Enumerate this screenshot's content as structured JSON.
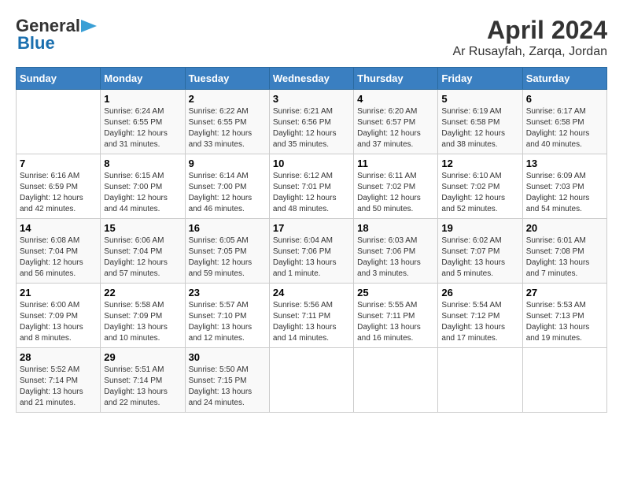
{
  "header": {
    "logo_general": "General",
    "logo_blue": "Blue",
    "title": "April 2024",
    "subtitle": "Ar Rusayfah, Zarqa, Jordan"
  },
  "days_of_week": [
    "Sunday",
    "Monday",
    "Tuesday",
    "Wednesday",
    "Thursday",
    "Friday",
    "Saturday"
  ],
  "weeks": [
    [
      {
        "day": "",
        "info": ""
      },
      {
        "day": "1",
        "info": "Sunrise: 6:24 AM\nSunset: 6:55 PM\nDaylight: 12 hours\nand 31 minutes."
      },
      {
        "day": "2",
        "info": "Sunrise: 6:22 AM\nSunset: 6:55 PM\nDaylight: 12 hours\nand 33 minutes."
      },
      {
        "day": "3",
        "info": "Sunrise: 6:21 AM\nSunset: 6:56 PM\nDaylight: 12 hours\nand 35 minutes."
      },
      {
        "day": "4",
        "info": "Sunrise: 6:20 AM\nSunset: 6:57 PM\nDaylight: 12 hours\nand 37 minutes."
      },
      {
        "day": "5",
        "info": "Sunrise: 6:19 AM\nSunset: 6:58 PM\nDaylight: 12 hours\nand 38 minutes."
      },
      {
        "day": "6",
        "info": "Sunrise: 6:17 AM\nSunset: 6:58 PM\nDaylight: 12 hours\nand 40 minutes."
      }
    ],
    [
      {
        "day": "7",
        "info": "Sunrise: 6:16 AM\nSunset: 6:59 PM\nDaylight: 12 hours\nand 42 minutes."
      },
      {
        "day": "8",
        "info": "Sunrise: 6:15 AM\nSunset: 7:00 PM\nDaylight: 12 hours\nand 44 minutes."
      },
      {
        "day": "9",
        "info": "Sunrise: 6:14 AM\nSunset: 7:00 PM\nDaylight: 12 hours\nand 46 minutes."
      },
      {
        "day": "10",
        "info": "Sunrise: 6:12 AM\nSunset: 7:01 PM\nDaylight: 12 hours\nand 48 minutes."
      },
      {
        "day": "11",
        "info": "Sunrise: 6:11 AM\nSunset: 7:02 PM\nDaylight: 12 hours\nand 50 minutes."
      },
      {
        "day": "12",
        "info": "Sunrise: 6:10 AM\nSunset: 7:02 PM\nDaylight: 12 hours\nand 52 minutes."
      },
      {
        "day": "13",
        "info": "Sunrise: 6:09 AM\nSunset: 7:03 PM\nDaylight: 12 hours\nand 54 minutes."
      }
    ],
    [
      {
        "day": "14",
        "info": "Sunrise: 6:08 AM\nSunset: 7:04 PM\nDaylight: 12 hours\nand 56 minutes."
      },
      {
        "day": "15",
        "info": "Sunrise: 6:06 AM\nSunset: 7:04 PM\nDaylight: 12 hours\nand 57 minutes."
      },
      {
        "day": "16",
        "info": "Sunrise: 6:05 AM\nSunset: 7:05 PM\nDaylight: 12 hours\nand 59 minutes."
      },
      {
        "day": "17",
        "info": "Sunrise: 6:04 AM\nSunset: 7:06 PM\nDaylight: 13 hours\nand 1 minute."
      },
      {
        "day": "18",
        "info": "Sunrise: 6:03 AM\nSunset: 7:06 PM\nDaylight: 13 hours\nand 3 minutes."
      },
      {
        "day": "19",
        "info": "Sunrise: 6:02 AM\nSunset: 7:07 PM\nDaylight: 13 hours\nand 5 minutes."
      },
      {
        "day": "20",
        "info": "Sunrise: 6:01 AM\nSunset: 7:08 PM\nDaylight: 13 hours\nand 7 minutes."
      }
    ],
    [
      {
        "day": "21",
        "info": "Sunrise: 6:00 AM\nSunset: 7:09 PM\nDaylight: 13 hours\nand 8 minutes."
      },
      {
        "day": "22",
        "info": "Sunrise: 5:58 AM\nSunset: 7:09 PM\nDaylight: 13 hours\nand 10 minutes."
      },
      {
        "day": "23",
        "info": "Sunrise: 5:57 AM\nSunset: 7:10 PM\nDaylight: 13 hours\nand 12 minutes."
      },
      {
        "day": "24",
        "info": "Sunrise: 5:56 AM\nSunset: 7:11 PM\nDaylight: 13 hours\nand 14 minutes."
      },
      {
        "day": "25",
        "info": "Sunrise: 5:55 AM\nSunset: 7:11 PM\nDaylight: 13 hours\nand 16 minutes."
      },
      {
        "day": "26",
        "info": "Sunrise: 5:54 AM\nSunset: 7:12 PM\nDaylight: 13 hours\nand 17 minutes."
      },
      {
        "day": "27",
        "info": "Sunrise: 5:53 AM\nSunset: 7:13 PM\nDaylight: 13 hours\nand 19 minutes."
      }
    ],
    [
      {
        "day": "28",
        "info": "Sunrise: 5:52 AM\nSunset: 7:14 PM\nDaylight: 13 hours\nand 21 minutes."
      },
      {
        "day": "29",
        "info": "Sunrise: 5:51 AM\nSunset: 7:14 PM\nDaylight: 13 hours\nand 22 minutes."
      },
      {
        "day": "30",
        "info": "Sunrise: 5:50 AM\nSunset: 7:15 PM\nDaylight: 13 hours\nand 24 minutes."
      },
      {
        "day": "",
        "info": ""
      },
      {
        "day": "",
        "info": ""
      },
      {
        "day": "",
        "info": ""
      },
      {
        "day": "",
        "info": ""
      }
    ]
  ]
}
